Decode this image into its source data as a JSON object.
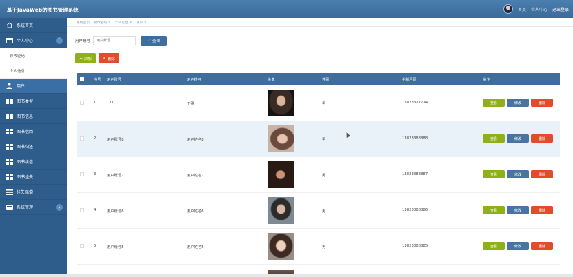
{
  "app": {
    "title": "基于JavaWeb的图书管理系统"
  },
  "topbar": {
    "links": [
      "首页",
      "个人中心",
      "退出登录"
    ]
  },
  "sidebar": {
    "items": [
      {
        "label": "系统首页",
        "icon": "home-icon"
      },
      {
        "label": "个人中心",
        "icon": "card-icon",
        "expanded": true
      },
      {
        "label": "修改密码",
        "sub": true
      },
      {
        "label": "个人信息",
        "sub": true
      },
      {
        "label": "用户",
        "icon": "user-icon",
        "active": true
      },
      {
        "label": "图书类型",
        "icon": "grid-icon"
      },
      {
        "label": "图书信息",
        "icon": "grid-icon"
      },
      {
        "label": "图书借阅",
        "icon": "grid-icon"
      },
      {
        "label": "图书归还",
        "icon": "grid-icon"
      },
      {
        "label": "图书续借",
        "icon": "grid-icon"
      },
      {
        "label": "图书挂失",
        "icon": "grid-icon"
      },
      {
        "label": "挂失赔偿",
        "icon": "list-icon"
      },
      {
        "label": "系统管理",
        "icon": "card-icon",
        "expandable": true
      }
    ]
  },
  "breadcrumb": [
    "系统首页",
    "修改密码 ×",
    "个人信息 ×",
    "用户 ×"
  ],
  "search": {
    "label": "用户账号",
    "placeholder": "用户账号",
    "button": "查询"
  },
  "actions": {
    "add": "添加",
    "delete": "删除"
  },
  "table": {
    "headers": [
      "序号",
      "用户账号",
      "用户姓名",
      "头像",
      "性别",
      "手机号码",
      "操作"
    ],
    "rows": [
      {
        "no": "1",
        "account": "111",
        "name": "王强",
        "gender": "男",
        "phone": "13823877774"
      },
      {
        "no": "2",
        "account": "用户账号8",
        "name": "用户姓名8",
        "gender": "男",
        "phone": "13823888888"
      },
      {
        "no": "3",
        "account": "用户账号7",
        "name": "用户姓名7",
        "gender": "男",
        "phone": "13823888887"
      },
      {
        "no": "4",
        "account": "用户账号6",
        "name": "用户姓名6",
        "gender": "男",
        "phone": "13823888886"
      },
      {
        "no": "5",
        "account": "用户账号5",
        "name": "用户姓名5",
        "gender": "男",
        "phone": "13823888885"
      }
    ],
    "ops": {
      "view": "查看",
      "edit": "修改",
      "remove": "删除"
    }
  },
  "colors": {
    "topbar": "#3b6a98",
    "sidebar": "#2e5d8c",
    "header": "#3f6d9c",
    "green": "#8fb01a",
    "red": "#e34b2b",
    "highlight": "#e9f1f9"
  }
}
